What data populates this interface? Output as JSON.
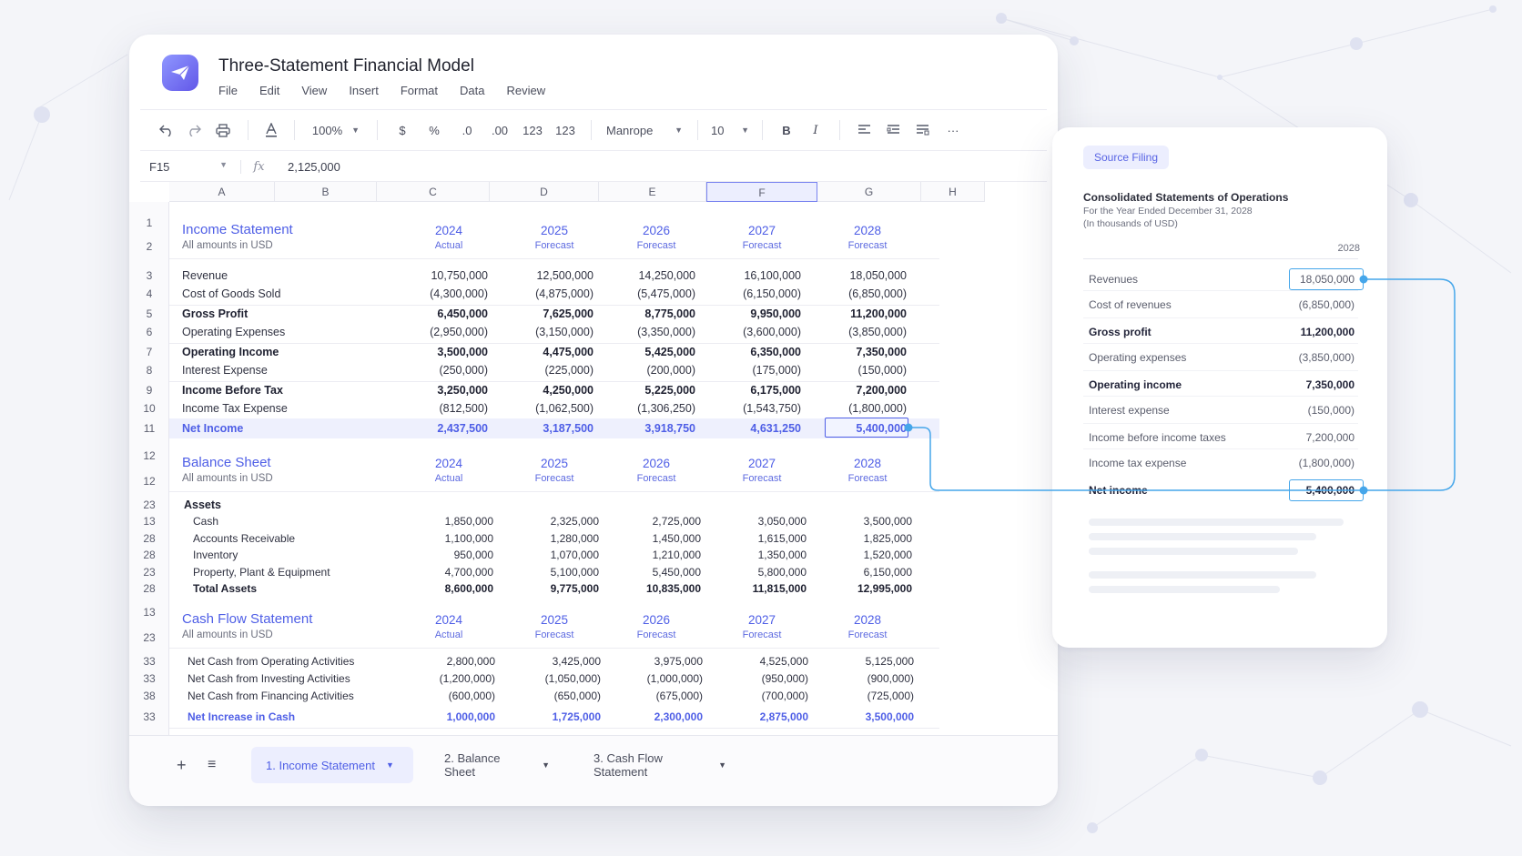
{
  "app": {
    "title": "Three-Statement Financial Model",
    "menu": [
      "File",
      "Edit",
      "View",
      "Insert",
      "Format",
      "Data",
      "Review"
    ]
  },
  "toolbar": {
    "zoom": "100%",
    "currency": "$",
    "percent": "%",
    "dec_decrease": ".0",
    "dec_increase": ".00",
    "format_123a": "123",
    "format_123b": "123",
    "font": "Manrope",
    "font_size": "10",
    "bold": "B",
    "italic": "I",
    "more": "···"
  },
  "formula_bar": {
    "cell_ref": "F15",
    "fx": "fx",
    "value": "2,125,000"
  },
  "columns": [
    "A",
    "B",
    "C",
    "D",
    "E",
    "F",
    "G",
    "H"
  ],
  "income_statement": {
    "title": "Income Statement",
    "subtitle": "All amounts in USD",
    "years": [
      "2024",
      "2025",
      "2026",
      "2027",
      "2028"
    ],
    "year_labels": [
      "Actual",
      "Forecast",
      "Forecast",
      "Forecast",
      "Forecast"
    ],
    "rows": [
      {
        "n": "3",
        "label": "Revenue",
        "values": [
          "10,750,000",
          "12,500,000",
          "14,250,000",
          "16,100,000",
          "18,050,000"
        ]
      },
      {
        "n": "4",
        "label": "Cost of Goods Sold",
        "values": [
          "(4,300,000)",
          "(4,875,000)",
          "(5,475,000)",
          "(6,150,000)",
          "(6,850,000)"
        ]
      },
      {
        "n": "5",
        "label": "Gross Profit",
        "bold": true,
        "values": [
          "6,450,000",
          "7,625,000",
          "8,775,000",
          "9,950,000",
          "11,200,000"
        ]
      },
      {
        "n": "6",
        "label": "Operating Expenses",
        "values": [
          "(2,950,000)",
          "(3,150,000)",
          "(3,350,000)",
          "(3,600,000)",
          "(3,850,000)"
        ]
      },
      {
        "n": "7",
        "label": "Operating Income",
        "bold": true,
        "values": [
          "3,500,000",
          "4,475,000",
          "5,425,000",
          "6,350,000",
          "7,350,000"
        ]
      },
      {
        "n": "8",
        "label": "Interest Expense",
        "values": [
          "(250,000)",
          "(225,000)",
          "(200,000)",
          "(175,000)",
          "(150,000)"
        ]
      },
      {
        "n": "9",
        "label": "Income Before Tax",
        "bold": true,
        "values": [
          "3,250,000",
          "4,250,000",
          "5,225,000",
          "6,175,000",
          "7,200,000"
        ]
      },
      {
        "n": "10",
        "label": "Income Tax Expense",
        "values": [
          "(812,500)",
          "(1,062,500)",
          "(1,306,250)",
          "(1,543,750)",
          "(1,800,000)"
        ]
      },
      {
        "n": "11",
        "label": "Net Income",
        "net": true,
        "values": [
          "2,437,500",
          "3,187,500",
          "3,918,750",
          "4,631,250",
          "5,400,000"
        ]
      }
    ]
  },
  "balance_sheet": {
    "title": "Balance Sheet",
    "subtitle": "All amounts in USD",
    "years": [
      "2024",
      "2025",
      "2026",
      "2027",
      "2028"
    ],
    "year_labels": [
      "Actual",
      "Forecast",
      "Forecast",
      "Forecast",
      "Forecast"
    ],
    "assets_label": "Assets",
    "rows": [
      {
        "n": "13",
        "label": "Cash",
        "values": [
          "1,850,000",
          "2,325,000",
          "2,725,000",
          "3,050,000",
          "3,500,000"
        ]
      },
      {
        "n": "28",
        "label": "Accounts Receivable",
        "values": [
          "1,100,000",
          "1,280,000",
          "1,450,000",
          "1,615,000",
          "1,825,000"
        ]
      },
      {
        "n": "28",
        "label": "Inventory",
        "values": [
          "950,000",
          "1,070,000",
          "1,210,000",
          "1,350,000",
          "1,520,000"
        ]
      },
      {
        "n": "23",
        "label": "Property, Plant & Equipment",
        "values": [
          "4,700,000",
          "5,100,000",
          "5,450,000",
          "5,800,000",
          "6,150,000"
        ]
      },
      {
        "n": "28",
        "label": "Total Assets",
        "bold": true,
        "values": [
          "8,600,000",
          "9,775,000",
          "10,835,000",
          "11,815,000",
          "12,995,000"
        ]
      }
    ]
  },
  "cash_flow": {
    "title": "Cash Flow Statement",
    "subtitle": "All amounts in USD",
    "years": [
      "2024",
      "2025",
      "2026",
      "2027",
      "2028"
    ],
    "year_labels": [
      "Actual",
      "Forecast",
      "Forecast",
      "Forecast",
      "Forecast"
    ],
    "rows": [
      {
        "n": "33",
        "label": "Net Cash from Operating Activities",
        "values": [
          "2,800,000",
          "3,425,000",
          "3,975,000",
          "4,525,000",
          "5,125,000"
        ]
      },
      {
        "n": "33",
        "label": "Net Cash from Investing Activities",
        "values": [
          "(1,200,000)",
          "(1,050,000)",
          "(1,000,000)",
          "(950,000)",
          "(900,000)"
        ]
      },
      {
        "n": "38",
        "label": "Net Cash from Financing Activities",
        "values": [
          "(600,000)",
          "(650,000)",
          "(675,000)",
          "(700,000)",
          "(725,000)"
        ]
      },
      {
        "n": "33",
        "label": "Net Increase in Cash",
        "net": true,
        "values": [
          "1,000,000",
          "1,725,000",
          "2,300,000",
          "2,875,000",
          "3,500,000"
        ]
      }
    ]
  },
  "row_numbers_misc": {
    "r1": "1",
    "r2": "2",
    "bs_title": "12",
    "bs_sub": "12",
    "assets": "23",
    "cf_title": "13",
    "cf_sub": "23"
  },
  "tabs": {
    "add": "+",
    "list": "≡",
    "items": [
      "1. Income Statement",
      "2. Balance Sheet",
      "3. Cash Flow Statement"
    ]
  },
  "filing": {
    "badge": "Source Filing",
    "title": "Consolidated Statements of Operations",
    "sub1": "For the Year Ended December 31, 2028",
    "sub2": "(In thousands of USD)",
    "year": "2028",
    "rows": [
      {
        "label": "Revenues",
        "value": "18,050,000",
        "boxed": true
      },
      {
        "label": "Cost of revenues",
        "value": "(6,850,000)"
      },
      {
        "label": "Gross profit",
        "value": "11,200,000",
        "bold": true
      },
      {
        "label": "Operating expenses",
        "value": "(3,850,000)"
      },
      {
        "label": "Operating income",
        "value": "7,350,000",
        "bold": true
      },
      {
        "label": "Interest expense",
        "value": "(150,000)"
      },
      {
        "label": "Income before income taxes",
        "value": "7,200,000"
      },
      {
        "label": "Income tax expense",
        "value": "(1,800,000)"
      },
      {
        "label": "Net income",
        "value": "5,400,000",
        "boxed": true,
        "strong": true
      }
    ]
  },
  "colors": {
    "accent": "#4e5ee6",
    "link": "#45a6ea",
    "selection_bg": "#eceefe"
  }
}
